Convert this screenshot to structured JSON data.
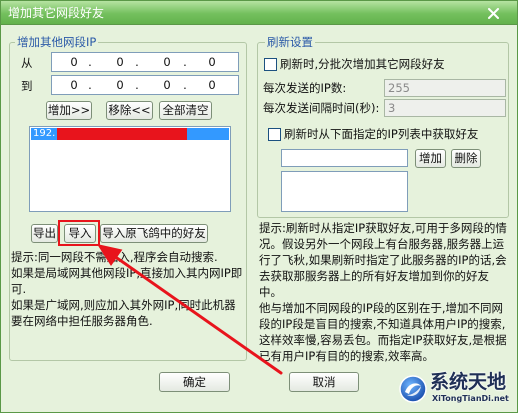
{
  "window": {
    "title": "增加其它网段好友",
    "close_icon": "close-icon"
  },
  "left": {
    "group_label": "增加其他网段IP",
    "from_label": "从",
    "to_label": "到",
    "ip_separator": ".",
    "from_ip": [
      "0",
      "0",
      "0",
      "0"
    ],
    "to_ip": [
      "0",
      "0",
      "0",
      "0"
    ],
    "add_button": "增加>>",
    "remove_button": "移除<<",
    "clear_button": "全部清空",
    "list_items": [
      {
        "text": "192.",
        "selected": true
      }
    ],
    "export_button": "导出",
    "import_button": "导入",
    "import_feige_button": "导入原飞鸽中的好友",
    "hint": [
      "提示:同一网段不需加入,程序会自动搜索.",
      "如果是局域网其他网段IP,直接加入其内网IP即可.",
      "如果是广域网,则应加入其外网IP,同时此机器要在网络中担任服务器角色."
    ]
  },
  "right": {
    "group_label": "刷新设置",
    "batch_checkbox": {
      "label": "刷新时,分批次增加其它网段好友",
      "checked": false
    },
    "ips_per_send_label": "每次发送的IP数:",
    "ips_per_send_value": "255",
    "interval_label": "每次发送间隔时间(秒):",
    "interval_value": "3",
    "ip_list_checkbox": {
      "label": "刷新时从下面指定的IP列表中获取好友",
      "checked": false
    },
    "add_button": "增加",
    "delete_button": "删除",
    "hint": [
      "提示:刷新时从指定IP获取好友,可用于多网段的情况。假设另外一个网段上有台服务器,服务器上运行了飞秋,如果刷新时指定了此服务器的IP的话,会去获取那服务器上的所有好友增加到你的好友中。",
      "他与增加不同网段的IP段的区别在于,增加不同网段的IP段是盲目的搜索,不知道具体用户IP的搜索,这样效率慢,容易丢包。而指定IP获取好友,是根据已有用户IP有目的的搜索,效率高。"
    ]
  },
  "footer": {
    "ok_button": "确定",
    "cancel_button": "取消"
  },
  "watermark": {
    "name": "系统天地",
    "url": "XiTongTianDi.net",
    "icon": "site-logo-icon"
  },
  "colors": {
    "title_bar": "#74c05e",
    "body": "#e6f2dc",
    "group_label": "#2b5aa8",
    "selection": "#3399ff",
    "annotation": "#e8141c"
  }
}
